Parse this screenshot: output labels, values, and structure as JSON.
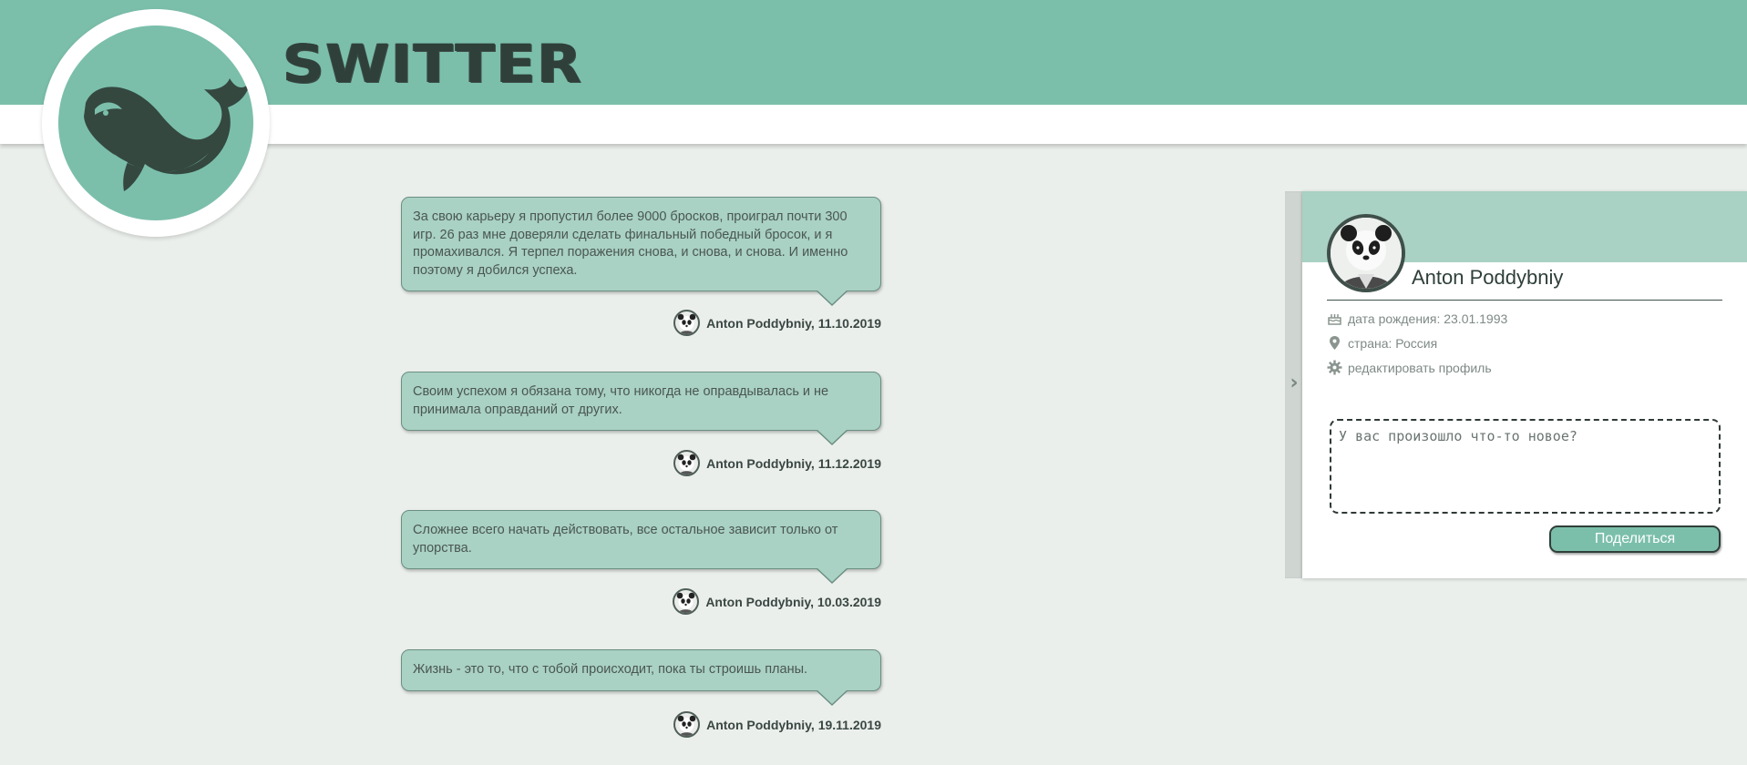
{
  "header": {
    "brand": "SWITTER",
    "logo_icon": "whale-icon"
  },
  "posts": [
    {
      "text": "За свою карьеру я пропустил более 9000 бросков, проиграл почти 300 игр. 26 раз мне доверяли сделать финальный победный бросок, и я промахивался. Я терпел поражения снова, и снова, и снова. И именно поэтому я добился успеха.",
      "author_date": "Anton Poddybniy, 11.10.2019"
    },
    {
      "text": "Своим успехом я обязана тому, что никогда не оправдывалась и не принимала оправданий от других.",
      "author_date": "Anton Poddybniy, 11.12.2019"
    },
    {
      "text": "Сложнее всего начать действовать, все остальное зависит только от упорства.",
      "author_date": "Anton Poddybniy, 10.03.2019"
    },
    {
      "text": "Жизнь - это то, что с тобой происходит, пока ты строишь планы.",
      "author_date": "Anton Poddybniy, 19.11.2019"
    }
  ],
  "profile": {
    "name": "Anton Poddybniy",
    "avatar_icon": "panda-avatar",
    "birth_date": "дата рождения: 23.01.1993",
    "country": "страна: Россия",
    "edit_profile": "редактировать профиль",
    "input_placeholder": "У вас произошло что-то новое?",
    "share_label": "Поделиться"
  },
  "colors": {
    "accent": "#7bbfab",
    "bubble": "#a9d1c4",
    "background": "#ebefeb",
    "dark": "#2f3f39"
  }
}
